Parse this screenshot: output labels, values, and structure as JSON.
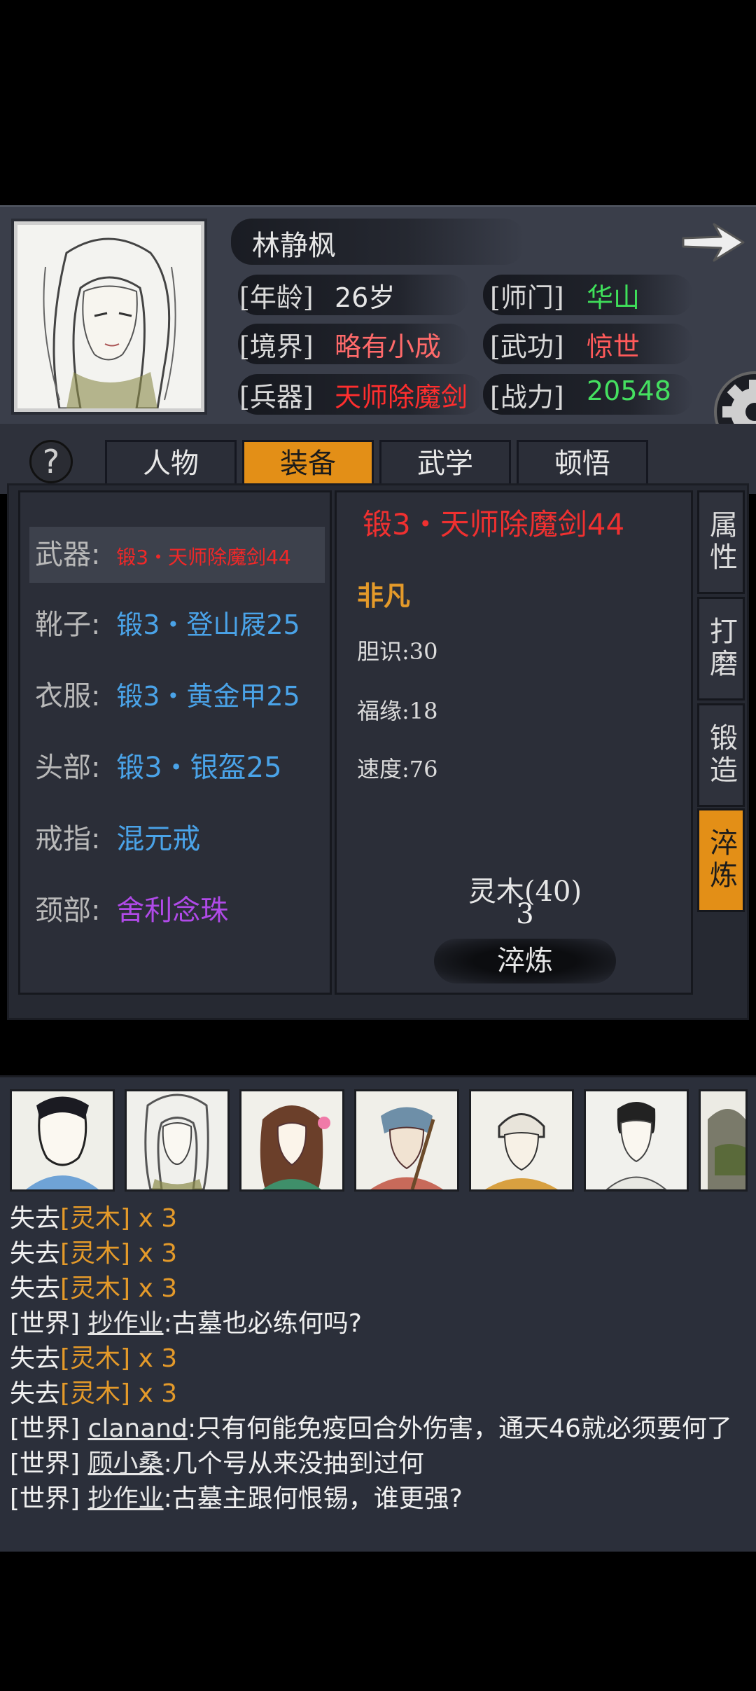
{
  "character": {
    "name": "林静枫",
    "stats": [
      {
        "label": "[年龄]",
        "value": "26岁",
        "color": "#e6e6e6"
      },
      {
        "label": "[师门]",
        "value": "华山",
        "color": "#3fe05a"
      },
      {
        "label": "[境界]",
        "value": "略有小成",
        "color": "#ff6a6a"
      },
      {
        "label": "[武功]",
        "value": "惊世",
        "color": "#ff5a5a"
      },
      {
        "label": "[兵器]",
        "value": "天师除魔剑",
        "color": "#ff2e2e"
      },
      {
        "label": "[战力]",
        "value": "20548",
        "color": "#45e060"
      }
    ]
  },
  "tabs": [
    "人物",
    "装备",
    "武学",
    "顿悟"
  ],
  "active_tab": "装备",
  "help_label": "?",
  "equipment": [
    {
      "slot": "武器:",
      "item": "锻3・天师除魔剑44",
      "color": "#f02828"
    },
    {
      "slot": "靴子:",
      "item": "锻3・登山屐25",
      "color": "#4aa3e8"
    },
    {
      "slot": "衣服:",
      "item": "锻3・黄金甲25",
      "color": "#4aa3e8"
    },
    {
      "slot": "头部:",
      "item": "锻3・银盔25",
      "color": "#4aa3e8"
    },
    {
      "slot": "戒指:",
      "item": "混元戒",
      "color": "#4aa3e8"
    },
    {
      "slot": "颈部:",
      "item": "舍利念珠",
      "color": "#b04ae8"
    }
  ],
  "detail": {
    "title": "锻3・天师除魔剑44",
    "rarity": "非凡",
    "attributes": [
      "胆识:30",
      "福缘:18",
      "速度:76"
    ],
    "material": "灵木(40)",
    "material_count": "3",
    "action_button": "淬炼"
  },
  "side_tabs": [
    "属性",
    "打磨",
    "锻造",
    "淬炼"
  ],
  "active_side_tab": "淬炼",
  "chat": [
    {
      "prefix": "失去",
      "item": "[灵木]",
      "suffix": " x 3"
    },
    {
      "prefix": "失去",
      "item": "[灵木]",
      "suffix": " x 3"
    },
    {
      "prefix": "失去",
      "item": "[灵木]",
      "suffix": " x 3"
    },
    {
      "prefix": "[世界] ",
      "user": "抄作业",
      "text": ":古墓也必练何吗?"
    },
    {
      "prefix": "失去",
      "item": "[灵木]",
      "suffix": " x 3"
    },
    {
      "prefix": "失去",
      "item": "[灵木]",
      "suffix": " x 3"
    },
    {
      "prefix": "[世界] ",
      "user": "clanand",
      "text": ":只有何能免疫回合外伤害，通天46就必须要何了"
    },
    {
      "prefix": "[世界] ",
      "user": "顾小桑",
      "text": ":几个号从来没抽到过何"
    },
    {
      "prefix": "[世界] ",
      "user": "抄作业",
      "text": ":古墓主跟何恨锡，谁更强?"
    }
  ],
  "icons": {
    "next": "arrow-right-icon",
    "settings": "gear-icon",
    "help": "question-icon"
  }
}
